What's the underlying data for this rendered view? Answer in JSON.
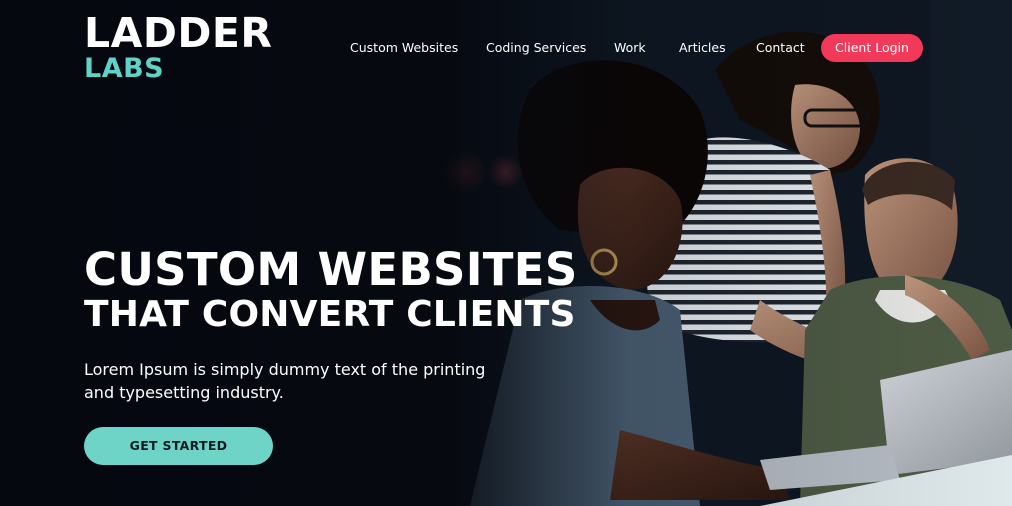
{
  "brand": {
    "line1": "LADDER",
    "line2": "LABS"
  },
  "nav": {
    "links": [
      "Custom Websites",
      "Coding Services",
      "Work",
      "Articles",
      "Contact"
    ],
    "login_label": "Client Login"
  },
  "hero": {
    "headline_line1": "CUSTOM WEBSITES",
    "headline_line2": "THAT CONVERT CLIENTS",
    "subtext": "Lorem Ipsum is simply dummy text of the printing and typesetting industry.",
    "cta_label": "GET STARTED"
  },
  "colors": {
    "accent_teal": "#6fd4c8",
    "login_red": "#f2395a",
    "background": "#060a12"
  }
}
